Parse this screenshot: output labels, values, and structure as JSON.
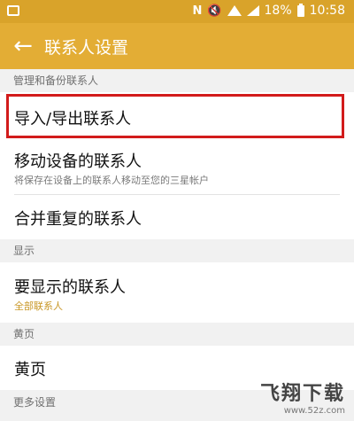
{
  "status_bar": {
    "nfc_label": "N",
    "mute_label": "🔇",
    "battery": "18%",
    "time": "10:58"
  },
  "app_bar": {
    "back_icon": "←",
    "title": "联系人设置"
  },
  "sections": {
    "manage": "管理和备份联系人",
    "display": "显示",
    "yellow_pages": "黄页",
    "more": "更多设置"
  },
  "items": {
    "import_export": {
      "title": "导入/导出联系人"
    },
    "move_device": {
      "title": "移动设备的联系人",
      "subtitle": "将保存在设备上的联系人移动至您的三星帐户"
    },
    "merge": {
      "title": "合并重复的联系人"
    },
    "show_contacts": {
      "title": "要显示的联系人",
      "subtitle": "全部联系人"
    },
    "yellow_pages": {
      "title": "黄页"
    }
  },
  "watermark": {
    "logo": "飞翔下载",
    "url": "www.52z.com"
  },
  "colors": {
    "status_bar": "#d9a32a",
    "app_bar": "#e3ad35",
    "highlight": "#d21b1b",
    "accent_text": "#c99726"
  }
}
